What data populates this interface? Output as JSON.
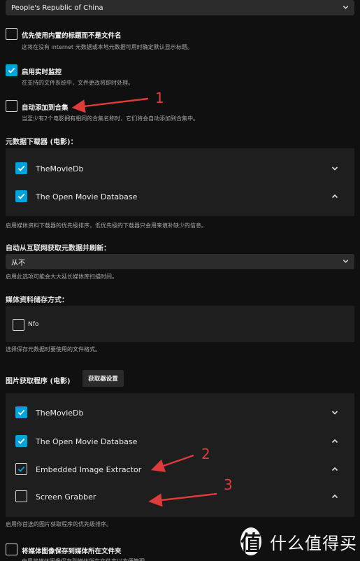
{
  "country_select": {
    "value": "People's Republic of China"
  },
  "options": {
    "prefer_embedded_titles": {
      "label": "优先使用内置的标题而不是文件名",
      "description": "这将在没有 internet 元数据或本地元数据可用时确定默认显示标题。",
      "checked": false
    },
    "realtime_monitor": {
      "label": "启用实时监控",
      "description": "在支持的文件系统中，文件更改将即时处理。",
      "checked": true
    },
    "auto_add_collection": {
      "label": "自动添加到合集",
      "description": "当至少有2个电影拥有相同的合集名称时，它们将会自动添加到合集中。",
      "checked": false
    }
  },
  "metadata_downloaders": {
    "heading": "元数据下载器 (电影)：",
    "items": [
      {
        "name": "TheMovieDb",
        "checked": true,
        "arrow": "down"
      },
      {
        "name": "The Open Movie Database",
        "checked": true,
        "arrow": "up"
      }
    ],
    "description": "启用媒体资料下载器的优先级排序，低优先级的下载器只会用来填补缺少的信息。"
  },
  "auto_refresh": {
    "heading": "自动从互联网获取元数据并刷新：",
    "value": "从不",
    "description": "启用此选项可能会大大延长媒体库扫描时间。"
  },
  "metadata_savers": {
    "heading": "媒体资料储存方式：",
    "items": [
      {
        "name": "Nfo",
        "checked": false
      }
    ],
    "description": "选择保存元数据时要使用的文件格式。"
  },
  "image_fetchers": {
    "heading": "图片获取程序 (电影)",
    "settings_button": "获取器设置",
    "items": [
      {
        "name": "TheMovieDb",
        "checked": true,
        "arrow": "down"
      },
      {
        "name": "The Open Movie Database",
        "checked": true,
        "arrow": "up"
      },
      {
        "name": "Embedded Image Extractor",
        "checked": true,
        "arrow": "up"
      },
      {
        "name": "Screen Grabber",
        "checked": false,
        "arrow": "up"
      }
    ],
    "description": "启用你首选的图片获取程序的优先级排序。"
  },
  "save_artwork": {
    "label": "将媒体图像保存到媒体所在文件夹",
    "description": "启用将媒体图像保存到媒体所在文件夹以方便管理。",
    "checked": false
  },
  "annotations": [
    "1",
    "2",
    "3"
  ],
  "watermark": {
    "logo": "值",
    "text": "什么值得买"
  },
  "colors": {
    "accent": "#00a4dc",
    "annotation": "#e03a3a",
    "background": "#101010",
    "panel": "#1e1e1e"
  }
}
